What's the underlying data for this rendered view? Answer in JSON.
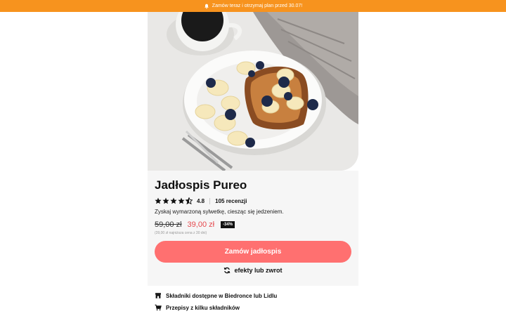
{
  "banner": {
    "text": "Zamów teraz i otrzymaj plan przed 30.07!",
    "icon": "bell-icon",
    "color": "#f7931e"
  },
  "hero": {
    "alt": "Tosty z masłem orzechowym, bananem i borówkami"
  },
  "product": {
    "title": "Jadłospis Pureo",
    "rating_value": "4.8",
    "rating_stars": 4.5,
    "reviews": "105 recenzji",
    "description": "Zyskaj wymarzoną sylwetkę, ciesząc się jedzeniem.",
    "old_price": "59,00 zł",
    "new_price": "39,00 zł",
    "discount": "-34%",
    "lowest_price_note": "(39,00 zł najniższa cena z 30 dni)"
  },
  "cta": {
    "label": "Zamów jadłospis",
    "color": "#ff7070"
  },
  "refund": {
    "label": "efekty lub zwrot",
    "icon": "refresh-icon"
  },
  "features": [
    {
      "label": "Składniki dostępne w Biedronce lub Lidlu",
      "icon": "store-icon"
    },
    {
      "label": "Przepisy z kilku składników",
      "icon": "cart-icon"
    }
  ]
}
